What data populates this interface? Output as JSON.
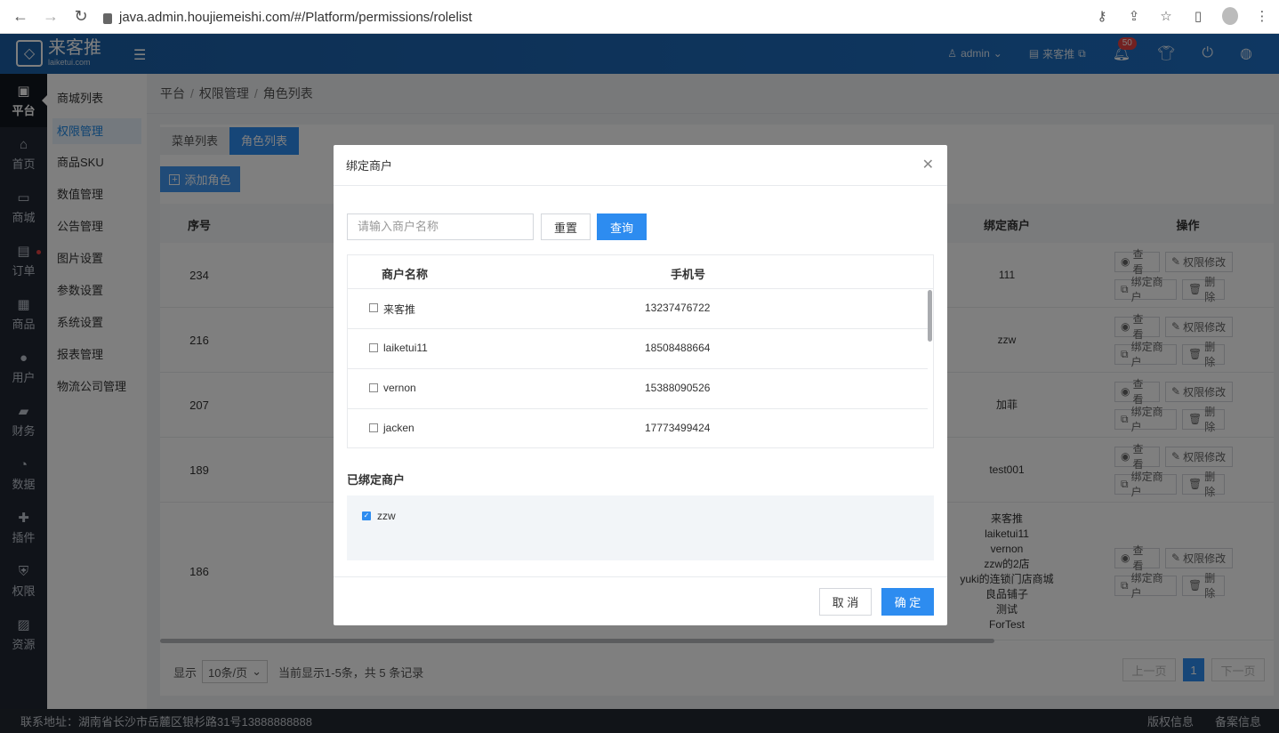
{
  "browser": {
    "url": "java.admin.houjiemeishi.com/#/Platform/permissions/rolelist"
  },
  "header": {
    "logo_title": "来客推",
    "logo_sub": "laiketui.com",
    "user": "admin",
    "store": "来客推",
    "notifications": "50"
  },
  "left_nav": [
    {
      "label": "平台",
      "icon": "platform-icon",
      "active": true
    },
    {
      "label": "首页",
      "icon": "home-icon"
    },
    {
      "label": "商城",
      "icon": "mall-icon"
    },
    {
      "label": "订单",
      "icon": "order-icon",
      "dot": true
    },
    {
      "label": "商品",
      "icon": "goods-icon"
    },
    {
      "label": "用户",
      "icon": "user-icon"
    },
    {
      "label": "财务",
      "icon": "wallet-icon"
    },
    {
      "label": "数据",
      "icon": "pie-chart-icon"
    },
    {
      "label": "插件",
      "icon": "puzzle-icon"
    },
    {
      "label": "权限",
      "icon": "shield-icon"
    },
    {
      "label": "资源",
      "icon": "image-icon"
    }
  ],
  "sub_menu": [
    "商城列表",
    "权限管理",
    "商品SKU",
    "数值管理",
    "公告管理",
    "图片设置",
    "参数设置",
    "系统设置",
    "报表管理",
    "物流公司管理"
  ],
  "sub_menu_active_index": 1,
  "breadcrumb": [
    "平台",
    "权限管理",
    "角色列表"
  ],
  "tabs": [
    "菜单列表",
    "角色列表"
  ],
  "add_role_label": "添加角色",
  "table": {
    "headers": {
      "id": "序号",
      "bound": "绑定商户",
      "ops": "操作"
    },
    "rows": [
      {
        "id": "234",
        "bound": [
          "111"
        ]
      },
      {
        "id": "216",
        "bound": [
          "zzw"
        ]
      },
      {
        "id": "207",
        "bound": [
          "加菲"
        ]
      },
      {
        "id": "189",
        "bound": [
          "test001"
        ]
      },
      {
        "id": "186",
        "bound": [
          "来客推",
          "laiketui11",
          "vernon",
          "zzw的2店",
          "yuki的连锁门店商城",
          "良品铺子",
          "测试",
          "ForTest"
        ]
      }
    ],
    "op_labels": {
      "view": "查看",
      "edit": "权限修改",
      "bind": "绑定商户",
      "delete": "删除"
    }
  },
  "pager": {
    "show_label": "显示",
    "page_size": "10条/页",
    "info": "当前显示1-5条，共 5 条记录",
    "prev": "上一页",
    "page": "1",
    "next": "下一页"
  },
  "footer": {
    "address": "联系地址：湖南省长沙市岳麓区银杉路31号13888888888",
    "copyright": "版权信息",
    "icp": "备案信息"
  },
  "modal": {
    "title": "绑定商户",
    "search_placeholder": "请输入商户名称",
    "reset_label": "重置",
    "query_label": "查询",
    "col_name": "商户名称",
    "col_phone": "手机号",
    "merchants": [
      {
        "name": "来客推",
        "phone": "13237476722"
      },
      {
        "name": "laiketui11",
        "phone": "18508488664"
      },
      {
        "name": "vernon",
        "phone": "15388090526"
      },
      {
        "name": "jacken",
        "phone": "17773499424"
      }
    ],
    "bound_title": "已绑定商户",
    "bound": [
      "zzw"
    ],
    "cancel_label": "取 消",
    "ok_label": "确 定"
  }
}
